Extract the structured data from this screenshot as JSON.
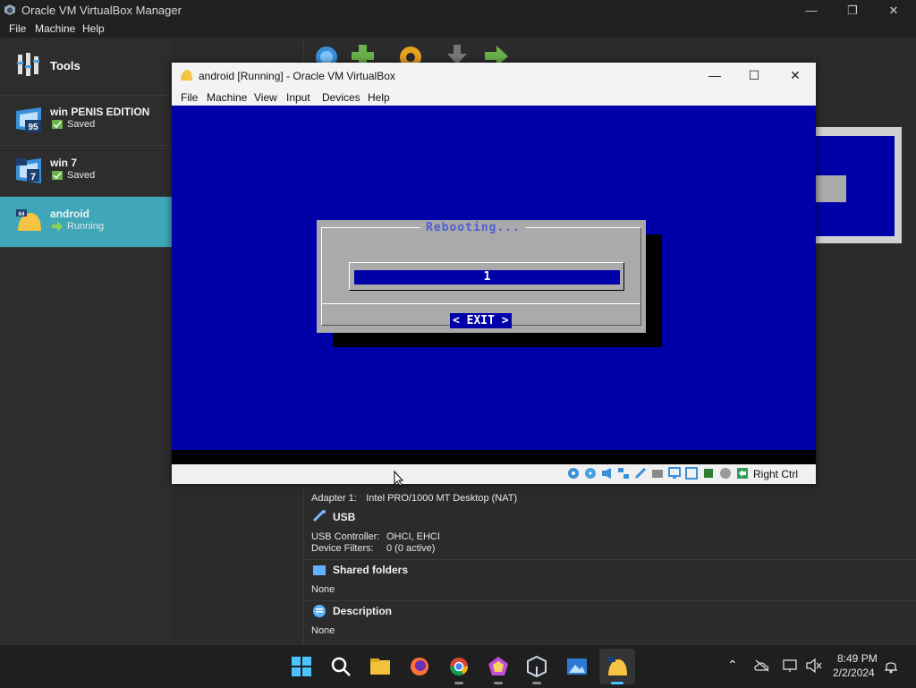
{
  "manager": {
    "title": "Oracle VM VirtualBox Manager",
    "menu": [
      "File",
      "Machine",
      "Help"
    ],
    "window_controls": {
      "minimize": "—",
      "maximize": "❐",
      "close": "✕"
    }
  },
  "sidebar": {
    "tools_label": "Tools",
    "vms": [
      {
        "name": "win PENIS EDITION",
        "state": "Saved",
        "os_badge": "95"
      },
      {
        "name": "win 7",
        "state": "Saved",
        "os_badge": "7"
      },
      {
        "name": "android",
        "state": "Running",
        "os_badge": "64"
      }
    ]
  },
  "toolbar_icons": [
    "new-icon",
    "add-icon",
    "settings-icon",
    "discard-icon",
    "start-icon"
  ],
  "details": {
    "network_line": {
      "label": "Adapter 1:",
      "value": "Intel PRO/1000 MT Desktop (NAT)"
    },
    "usb": {
      "header": "USB",
      "controller_label": "USB Controller:",
      "controller_value": "OHCI, EHCI",
      "filters_label": "Device Filters:",
      "filters_value": "0 (0 active)"
    },
    "shared_folders": {
      "header": "Shared folders",
      "value": "None"
    },
    "description": {
      "header": "Description",
      "value": "None"
    }
  },
  "vm_window": {
    "title": "android [Running] - Oracle VM VirtualBox",
    "menu": [
      "File",
      "Machine",
      "View",
      "Input",
      "Devices",
      "Help"
    ],
    "window_controls": {
      "minimize": "—",
      "maximize": "☐",
      "close": "✕"
    },
    "host_key": "Right Ctrl",
    "screen_color": "#0000a8"
  },
  "dialog": {
    "title": "Rebooting...",
    "gauge_value": "1",
    "exit_button": "< EXIT >"
  },
  "taskbar": {
    "apps": [
      "start-icon",
      "search-icon",
      "file-explorer-icon",
      "firefox-icon",
      "chrome-icon",
      "app-icon",
      "virtualbox-icon",
      "photos-icon",
      "android-vm-icon"
    ],
    "time": "8:49 PM",
    "date": "2/2/2024"
  }
}
